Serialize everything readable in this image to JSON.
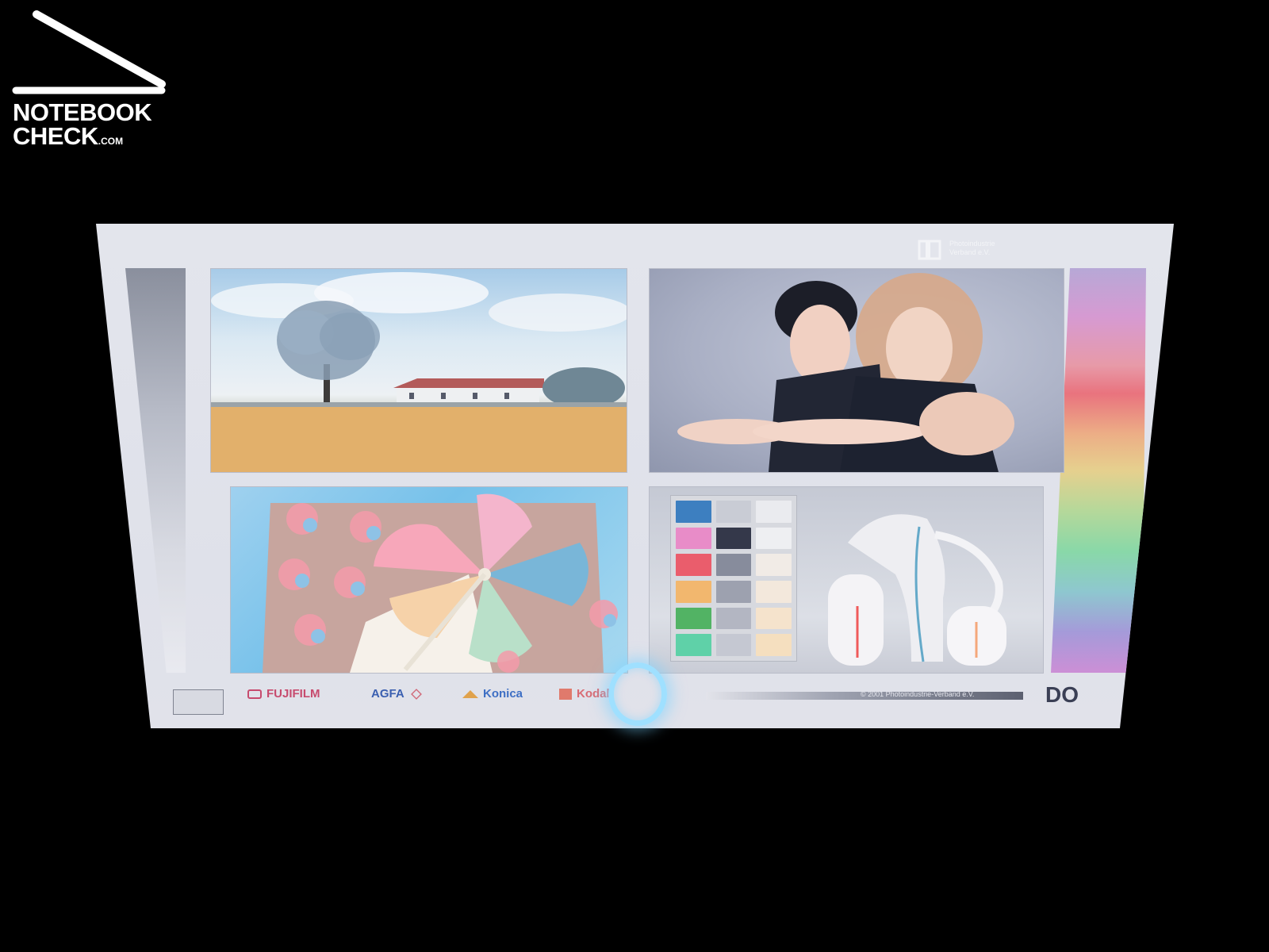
{
  "watermark": {
    "line1": "NOTEBOOK",
    "line2": "CHECK",
    "line2_suffix": ".COM"
  },
  "screen": {
    "brands": [
      "FUJIFILM",
      "AGFA",
      "Konica",
      "Kodak"
    ],
    "copyright": "© 2001 Photoindustrie-Verband e.V.",
    "corner_logo": {
      "line1": "Photoindustrie",
      "line2": "Verband e.V."
    },
    "bottom_right_logo": "DO"
  },
  "colors": {
    "background": "#000000",
    "ring_glow": "#9fe0ff",
    "fujifilm": "#c74b6e",
    "agfa": "#3a5fb0",
    "konica": "#3e6fc4",
    "kodak": "#d96b73"
  }
}
